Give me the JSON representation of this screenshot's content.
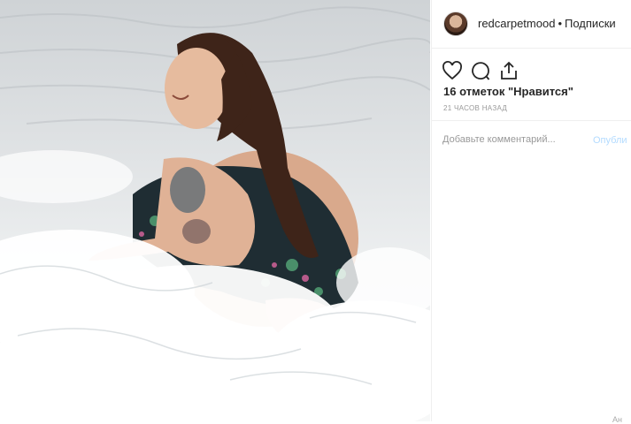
{
  "post": {
    "username": "redcarpetmood",
    "separator": "•",
    "follow_label": "Подписки",
    "likes_text": "16 отметок \"Нравится\"",
    "time_text": "21 ЧАСОВ НАЗАД",
    "comment_placeholder": "Добавьте комментарий...",
    "publish_label": "Опубли",
    "corner_text": "Ан"
  },
  "icons": {
    "like": "heart-icon",
    "comment": "comment-icon",
    "share": "share-icon"
  },
  "colors": {
    "text": "#262626",
    "muted": "#999999",
    "publish_disabled": "#b3dbff",
    "border": "#efefef"
  }
}
